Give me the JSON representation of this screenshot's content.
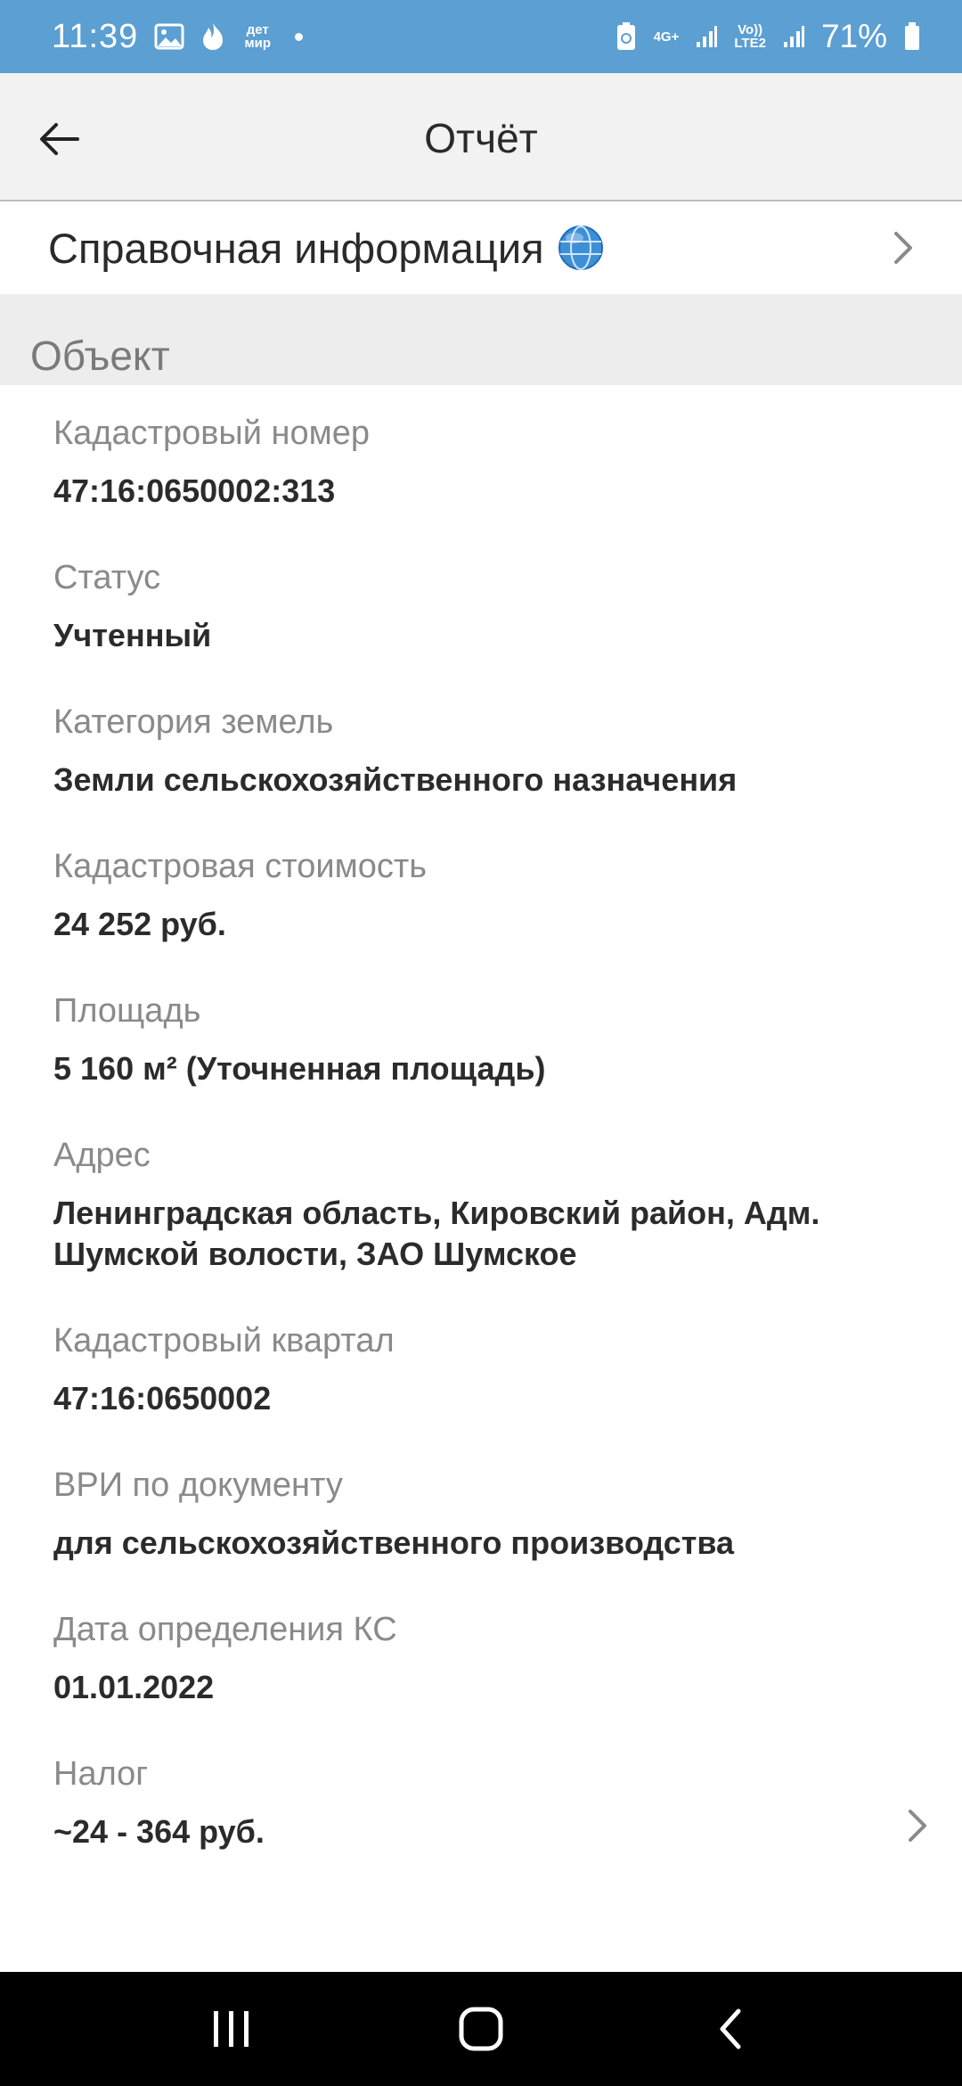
{
  "status_bar": {
    "time": "11:39",
    "notification_icons": [
      "image-icon",
      "flame-icon",
      "detmir-icon"
    ],
    "detmir_text": "дет мир",
    "network_1": "4G+",
    "network_2_top": "Vo))",
    "network_2_bottom": "LTE2",
    "battery": "71%"
  },
  "app_bar": {
    "title": "Отчёт",
    "back_icon": "arrow-left-icon"
  },
  "reference": {
    "label": "Справочная информация",
    "icon": "globe-icon"
  },
  "section": {
    "title": "Объект"
  },
  "fields": [
    {
      "label": "Кадастровый номер",
      "value": "47:16:0650002:313"
    },
    {
      "label": "Статус",
      "value": "Учтенный"
    },
    {
      "label": "Категория земель",
      "value": "Земли сельскохозяйственного назначения"
    },
    {
      "label": "Кадастровая стоимость",
      "value": "24 252 руб."
    },
    {
      "label": "Площадь",
      "value": "5 160 м² (Уточненная площадь)"
    },
    {
      "label": "Адрес",
      "value": "Ленинградская область, Кировский район, Адм. Шумской волости, ЗАО Шумское"
    },
    {
      "label": "Кадастровый квартал",
      "value": "47:16:0650002"
    },
    {
      "label": "ВРИ по документу",
      "value": "для сельскохозяйственного производства"
    },
    {
      "label": "Дата определения КС",
      "value": "01.01.2022"
    },
    {
      "label": "Налог",
      "value": "~24 - 364 руб."
    }
  ],
  "colors": {
    "status_bar": "#5b9fd3",
    "app_bar": "#f2f2f2",
    "section_bg": "#ededed",
    "label": "#8a8a8a",
    "value": "#2b2b2b"
  }
}
